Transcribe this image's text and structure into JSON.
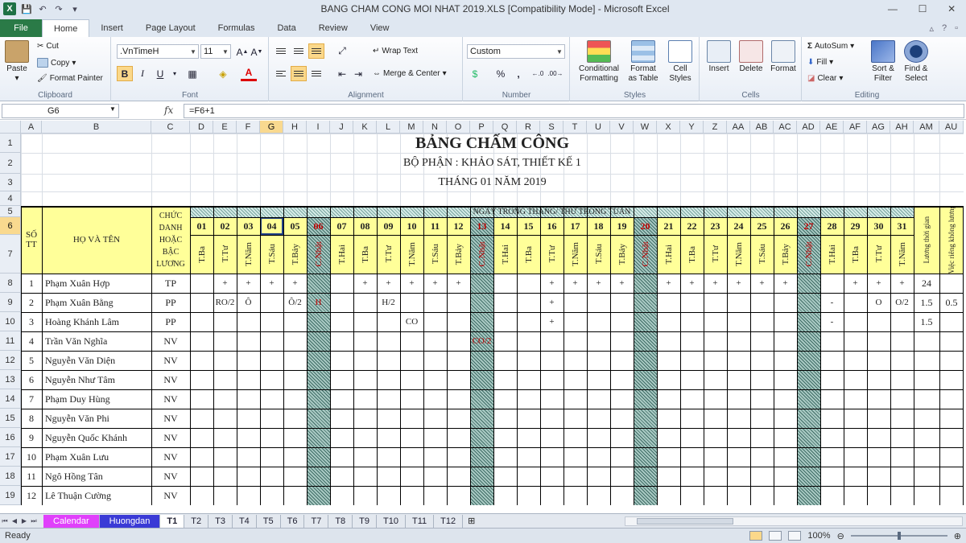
{
  "window": {
    "title": "BANG CHAM CONG MOI NHAT 2019.XLS  [Compatibility Mode]  -  Microsoft Excel",
    "logo": "X"
  },
  "tabs": [
    "File",
    "Home",
    "Insert",
    "Page Layout",
    "Formulas",
    "Data",
    "Review",
    "View"
  ],
  "ribbon": {
    "clipboard": {
      "label": "Clipboard",
      "paste": "Paste",
      "cut": "Cut",
      "copy": "Copy",
      "format_painter": "Format Painter"
    },
    "font": {
      "label": "Font",
      "name": ".VnTimeH",
      "size": "11",
      "bold": "B",
      "italic": "I",
      "underline": "U"
    },
    "alignment": {
      "label": "Alignment",
      "wrap": "Wrap Text",
      "merge": "Merge & Center"
    },
    "number": {
      "label": "Number",
      "format": "Custom",
      "percent": "%",
      "comma": ","
    },
    "styles": {
      "label": "Styles",
      "conditional": "Conditional Formatting",
      "format_table": "Format as Table",
      "cell_styles": "Cell Styles"
    },
    "cells": {
      "label": "Cells",
      "insert": "Insert",
      "delete": "Delete",
      "format": "Format"
    },
    "editing": {
      "label": "Editing",
      "autosum": "AutoSum",
      "fill": "Fill",
      "clear": "Clear",
      "sort": "Sort & Filter",
      "find": "Find & Select"
    }
  },
  "formula_bar": {
    "name_box": "G6",
    "fx": "fx",
    "formula": "=F6+1"
  },
  "sheet": {
    "columns": [
      "A",
      "B",
      "C",
      "D",
      "E",
      "F",
      "G",
      "H",
      "I",
      "J",
      "K",
      "L",
      "M",
      "N",
      "O",
      "P",
      "Q",
      "R",
      "S",
      "T",
      "U",
      "V",
      "W",
      "X",
      "Y",
      "Z",
      "AA",
      "AB",
      "AC",
      "AD",
      "AE",
      "AF",
      "AG",
      "AH",
      "AM",
      "AU"
    ],
    "selected_col": "G",
    "rows": [
      "1",
      "2",
      "3",
      "4",
      "5",
      "6",
      "7",
      "8",
      "9",
      "10",
      "11",
      "12",
      "13",
      "14",
      "15",
      "16",
      "17",
      "18",
      "19"
    ],
    "selected_row": "6",
    "title": "BẢNG CHẤM CÔNG",
    "department": "BỘ PHẬN : KHẢO SÁT, THIẾT KẾ 1",
    "month": "THÁNG 01 NĂM 2019",
    "hdr_stt": "SỐ TT",
    "hdr_name": "HỌ VÀ TÊN",
    "hdr_title": "CHỨC DANH HOẶC BẬC LƯƠNG",
    "hdr_days": "NGÀY TRONG THÁNG/ THỨ TRONG TUẦN",
    "hdr_luong": "Lương thời gian",
    "hdr_viec": "Việc riêng không lương",
    "days": [
      "01",
      "02",
      "03",
      "04",
      "05",
      "06",
      "07",
      "08",
      "09",
      "10",
      "11",
      "12",
      "13",
      "14",
      "15",
      "16",
      "17",
      "18",
      "19",
      "20",
      "21",
      "22",
      "23",
      "24",
      "25",
      "26",
      "27",
      "28",
      "29",
      "30",
      "31"
    ],
    "weekdays": [
      "T.Ba",
      "T.Tư",
      "T.Năm",
      "T.Sáu",
      "T.Bảy",
      "C.Nhật",
      "T.Hai",
      "T.Ba",
      "T.Tư",
      "T.Năm",
      "T.Sáu",
      "T.Bảy",
      "C.Nhật",
      "T.Hai",
      "T.Ba",
      "T.Tư",
      "T.Năm",
      "T.Sáu",
      "T.Bảy",
      "C.Nhật",
      "T.Hai",
      "T.Ba",
      "T.Tư",
      "T.Năm",
      "T.Sáu",
      "T.Bảy",
      "C.Nhật",
      "T.Hai",
      "T.Ba",
      "T.Tư",
      "T.Năm"
    ],
    "sundays": [
      5,
      12,
      19,
      26
    ],
    "employees": [
      {
        "stt": "1",
        "name": "Phạm Xuân Hợp",
        "title": "TP",
        "marks": {
          "1": "+",
          "2": "+",
          "3": "+",
          "4": "+",
          "7": "+",
          "8": "+",
          "9": "+",
          "10": "+",
          "11": "+",
          "15": "+",
          "16": "+",
          "17": "+",
          "18": "+",
          "20": "+",
          "21": "+",
          "22": "+",
          "23": "+",
          "24": "+",
          "25": "+",
          "28": "+",
          "29": "+",
          "30": "+"
        },
        "luong": "24",
        "viec": ""
      },
      {
        "stt": "2",
        "name": "Phạm Xuân Bằng",
        "title": "PP",
        "marks": {
          "1": "RO/2",
          "2": "Ô",
          "4": "Ô/2",
          "5": "H",
          "8": "H/2",
          "15": "+",
          "27": "-",
          "29": "O",
          "30": "O/2"
        },
        "luong": "1.5",
        "viec": "0.5"
      },
      {
        "stt": "3",
        "name": "Hoàng Khánh Lâm",
        "title": "PP",
        "marks": {
          "9": "CO",
          "15": "+",
          "27": "-"
        },
        "luong": "1.5",
        "viec": ""
      },
      {
        "stt": "4",
        "name": "Trần Văn Nghĩa",
        "title": "NV",
        "marks": {
          "12": "CO/2"
        },
        "luong": "",
        "viec": ""
      },
      {
        "stt": "5",
        "name": "Nguyễn Văn Diện",
        "title": "NV",
        "marks": {},
        "luong": "",
        "viec": ""
      },
      {
        "stt": "6",
        "name": "Nguyễn Như Tâm",
        "title": "NV",
        "marks": {},
        "luong": "",
        "viec": ""
      },
      {
        "stt": "7",
        "name": "Phạm Duy Hùng",
        "title": "NV",
        "marks": {},
        "luong": "",
        "viec": ""
      },
      {
        "stt": "8",
        "name": "Nguyễn Văn Phi",
        "title": "NV",
        "marks": {},
        "luong": "",
        "viec": ""
      },
      {
        "stt": "9",
        "name": "Nguyễn Quốc Khánh",
        "title": "NV",
        "marks": {},
        "luong": "",
        "viec": ""
      },
      {
        "stt": "10",
        "name": "Phạm Xuân Lưu",
        "title": "NV",
        "marks": {},
        "luong": "",
        "viec": ""
      },
      {
        "stt": "11",
        "name": "Ngô Hồng Tân",
        "title": "NV",
        "marks": {},
        "luong": "",
        "viec": ""
      },
      {
        "stt": "12",
        "name": "Lê Thuận Cường",
        "title": "NV",
        "marks": {},
        "luong": "",
        "viec": ""
      }
    ]
  },
  "sheet_tabs": [
    {
      "label": "Calendar",
      "color": "#e040fb"
    },
    {
      "label": "Huongdan",
      "color": "#3a3ad6"
    },
    {
      "label": "T1",
      "color": ""
    },
    {
      "label": "T2",
      "color": ""
    },
    {
      "label": "T3",
      "color": ""
    },
    {
      "label": "T4",
      "color": ""
    },
    {
      "label": "T5",
      "color": ""
    },
    {
      "label": "T6",
      "color": ""
    },
    {
      "label": "T7",
      "color": ""
    },
    {
      "label": "T8",
      "color": ""
    },
    {
      "label": "T9",
      "color": ""
    },
    {
      "label": "T10",
      "color": ""
    },
    {
      "label": "T11",
      "color": ""
    },
    {
      "label": "T12",
      "color": ""
    }
  ],
  "active_tab": "T1",
  "status": {
    "ready": "Ready",
    "zoom": "100%"
  }
}
